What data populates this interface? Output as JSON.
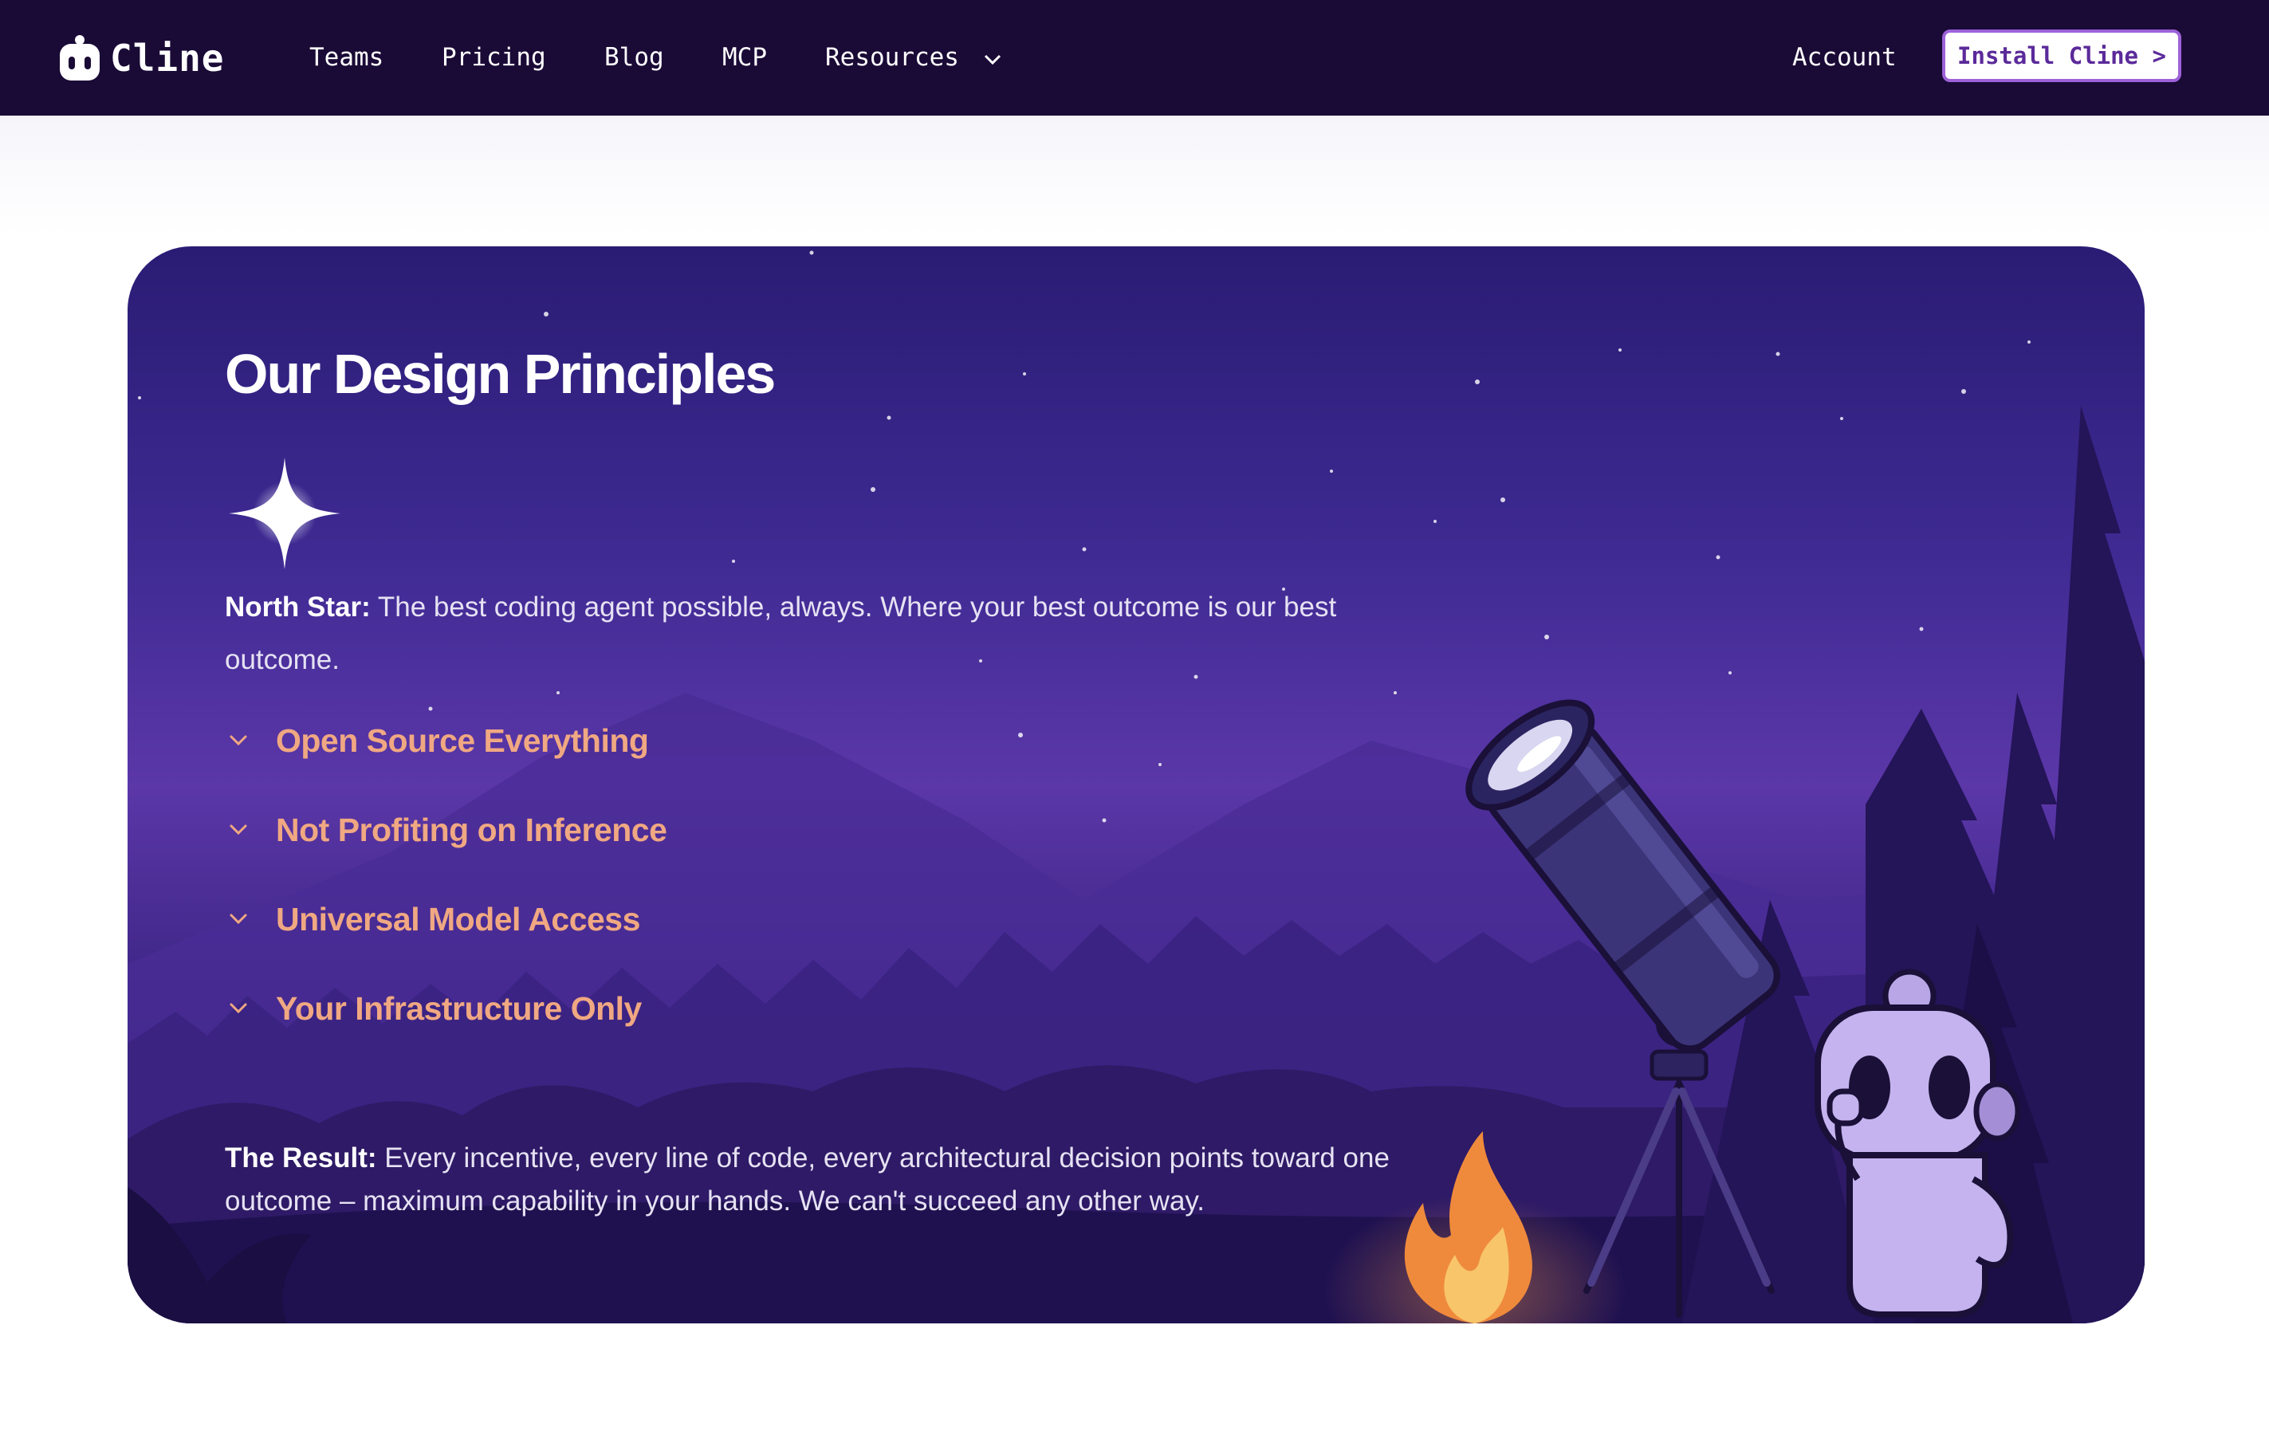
{
  "nav": {
    "logo_text": "Cline",
    "links": [
      "Teams",
      "Pricing",
      "Blog",
      "MCP",
      "Resources"
    ],
    "account": "Account",
    "install_label": "Install Cline >"
  },
  "principles": {
    "title": "Our Design Principles",
    "north_star_label": "North Star:",
    "north_star_text": " The best coding agent possible, always. Where your best outcome is our best outcome.",
    "items": [
      "Open Source Everything",
      "Not Profiting on Inference",
      "Universal Model Access",
      "Your Infrastructure Only"
    ],
    "result_label": "The Result:",
    "result_text": " Every incentive, every line of code, every architectural decision points toward one outcome – maximum capability in your hands. We can't succeed any other way."
  },
  "colors": {
    "nav_bg": "#1a0a36",
    "accent": "#f0a882",
    "button_border": "#9d62d8",
    "card_top": "#2a1c74",
    "card_mid": "#5b37a8"
  },
  "icons": {
    "logo": "robot-head-icon",
    "dropdown": "chevron-down-icon",
    "sparkle": "sparkle-star-icon"
  }
}
